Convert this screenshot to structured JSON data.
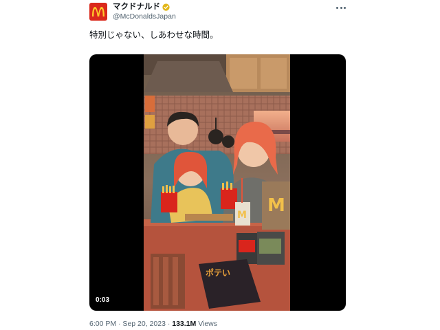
{
  "author": {
    "name": "マクドナルド",
    "handle": "@McDonaldsJapan",
    "avatar_icon": "mcdonalds-logo-icon",
    "brand_color": "#da291c",
    "verified_color": "#e2b719"
  },
  "menu_icon": "more-options-icon",
  "tweet": {
    "text": "特別じゃない、しあわせな時間。"
  },
  "media": {
    "type": "video",
    "duration": "0:03"
  },
  "meta": {
    "timestamp": "6:00 PM · Sep 20, 2023 · ",
    "views_count": "133.1M",
    "views_label": " Views"
  }
}
